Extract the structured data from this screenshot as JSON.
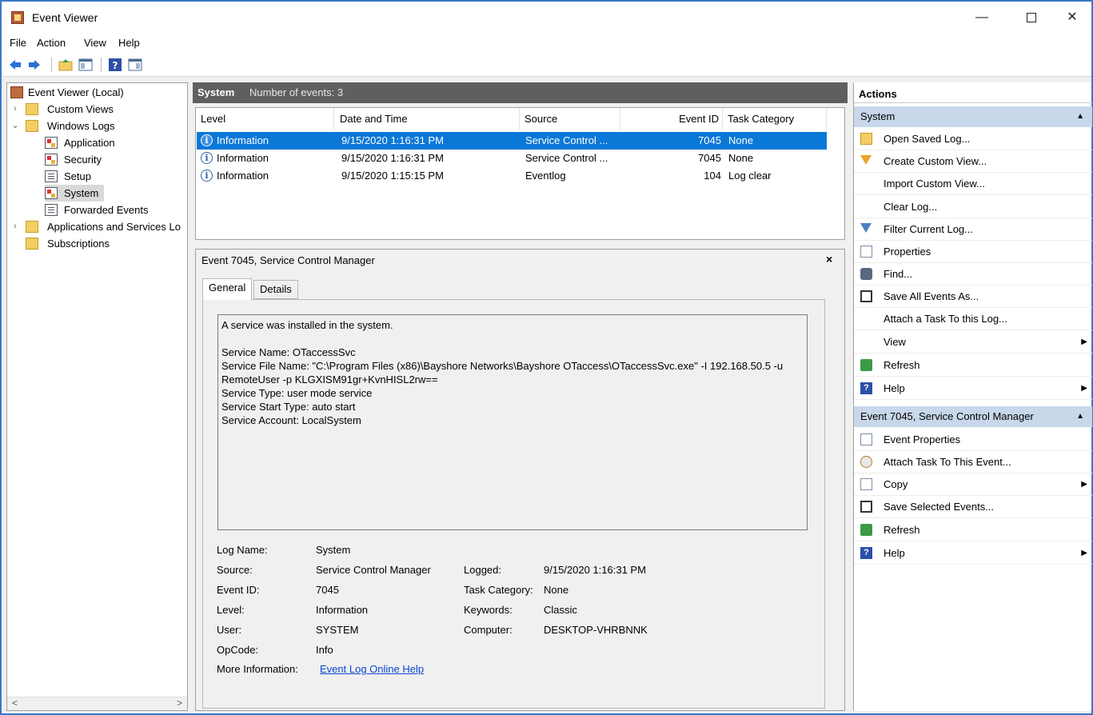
{
  "window": {
    "title": "Event Viewer",
    "minimize": "—",
    "close": "✕"
  },
  "menu": [
    "File",
    "Action",
    "View",
    "Help"
  ],
  "tree": {
    "items": [
      {
        "label": "Event Viewer (Local)"
      },
      {
        "label": "Custom Views",
        "arrow": "›"
      },
      {
        "label": "Windows Logs",
        "arrow": "⌄"
      },
      {
        "label": "Application"
      },
      {
        "label": "Security"
      },
      {
        "label": "Setup"
      },
      {
        "label": "System"
      },
      {
        "label": "Forwarded Events"
      },
      {
        "label": "Applications and Services Lo",
        "arrow": "›"
      },
      {
        "label": "Subscriptions"
      }
    ],
    "scroll_left": "<",
    "scroll_right": ">"
  },
  "center": {
    "title": "System",
    "count": "Number of events: 3"
  },
  "events": {
    "columns": [
      "Level",
      "Date and Time",
      "Source",
      "Event ID",
      "Task Category"
    ],
    "rows": [
      {
        "level": "Information",
        "datetime": "9/15/2020 1:16:31 PM",
        "source": "Service Control ...",
        "event_id": "7045",
        "task": "None"
      },
      {
        "level": "Information",
        "datetime": "9/15/2020 1:16:31 PM",
        "source": "Service Control ...",
        "event_id": "7045",
        "task": "None"
      },
      {
        "level": "Information",
        "datetime": "9/15/2020 1:15:15 PM",
        "source": "Eventlog",
        "event_id": "104",
        "task": "Log clear"
      }
    ]
  },
  "detail": {
    "title": "Event 7045, Service Control Manager",
    "close": "×",
    "tabs": [
      "General",
      "Details"
    ],
    "description": [
      "A service was installed in the system.",
      "",
      "Service Name:  OTaccessSvc",
      "Service File Name:  \"C:\\Program Files (x86)\\Bayshore Networks\\Bayshore OTaccess\\OTaccessSvc.exe\" -I 192.168.50.5 -u",
      "RemoteUser -p KLGXISM91gr+KvnHISL2rw==",
      "Service Type:  user mode service",
      "Service Start Type:  auto start",
      "Service Account:  LocalSystem"
    ],
    "fields": {
      "log_name_label": "Log Name:",
      "log_name": "System",
      "source_label": "Source:",
      "source": "Service Control Manager",
      "logged_label": "Logged:",
      "logged": "9/15/2020 1:16:31 PM",
      "event_id_label": "Event ID:",
      "event_id": "7045",
      "task_label": "Task Category:",
      "task": "None",
      "level_label": "Level:",
      "level": "Information",
      "keywords_label": "Keywords:",
      "keywords": "Classic",
      "user_label": "User:",
      "user": "SYSTEM",
      "computer_label": "Computer:",
      "computer": "DESKTOP-VHRBNNK",
      "opcode_label": "OpCode:",
      "opcode": "Info",
      "more_label": "More Information:",
      "more_link": "Event Log Online Help"
    }
  },
  "actions": {
    "header": "Actions",
    "group1": "System",
    "group1_items": [
      {
        "label": "Open Saved Log...",
        "icon": "open-folder-icon"
      },
      {
        "label": "Create Custom View...",
        "icon": "filter-icon"
      },
      {
        "label": "Import Custom View..."
      },
      {
        "label": "Clear Log..."
      },
      {
        "label": "Filter Current Log...",
        "icon": "filter-icon"
      },
      {
        "label": "Properties",
        "icon": "properties-icon"
      },
      {
        "label": "Find...",
        "icon": "binoculars-icon"
      },
      {
        "label": "Save All Events As...",
        "icon": "save-icon"
      },
      {
        "label": "Attach a Task To this Log..."
      },
      {
        "label": "View",
        "submenu": true
      },
      {
        "label": "Refresh",
        "icon": "refresh-icon"
      },
      {
        "label": "Help",
        "icon": "help-icon",
        "submenu": true
      }
    ],
    "group2": "Event 7045, Service Control Manager",
    "group2_items": [
      {
        "label": "Event Properties",
        "icon": "properties-icon"
      },
      {
        "label": "Attach Task To This Event...",
        "icon": "task-icon"
      },
      {
        "label": "Copy",
        "icon": "copy-icon",
        "submenu": true
      },
      {
        "label": "Save Selected Events...",
        "icon": "save-icon"
      },
      {
        "label": "Refresh",
        "icon": "refresh-icon"
      },
      {
        "label": "Help",
        "icon": "help-icon",
        "submenu": true
      }
    ]
  },
  "colors": {
    "selection": "#0a78d7",
    "header_dark": "#5f5f5f",
    "group_bg": "#c8d7ea",
    "window_border": "#3a78c8"
  }
}
